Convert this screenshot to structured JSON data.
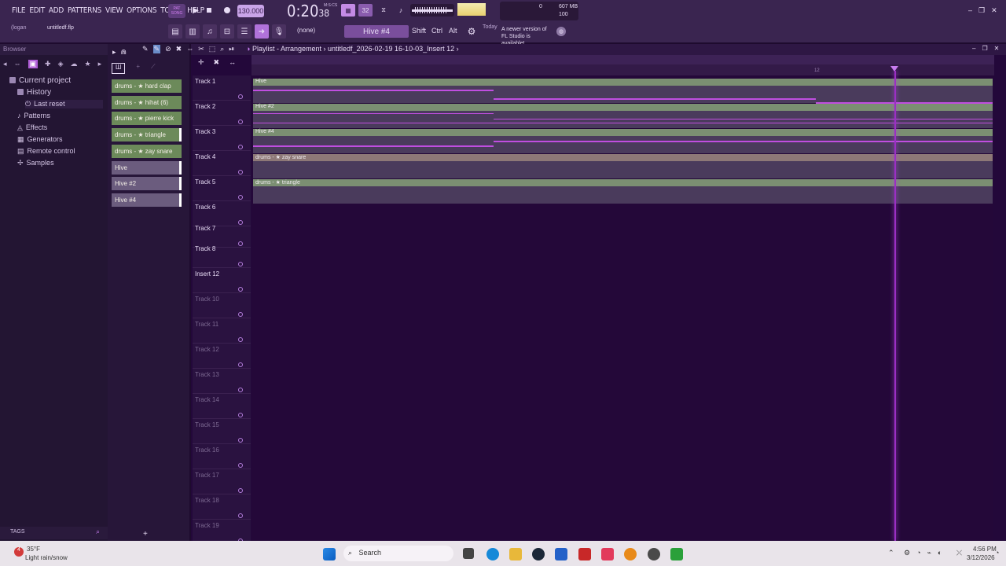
{
  "menubar": {
    "items": [
      "FILE",
      "EDIT",
      "ADD",
      "PATTERNS",
      "VIEW",
      "OPTIONS",
      "TOOLS",
      "HELP"
    ],
    "pat_song": "PAT SONG",
    "tempo": "130.000",
    "time_main": "0:20",
    "time_sub": "38",
    "time_format": "M:S:CS",
    "cpu_label": "607 MB",
    "cpu_value": "100",
    "cpu_zero": "0"
  },
  "hintbar": {
    "user": "(logan",
    "file": "untitledf.flp",
    "pattern_none": "(none)",
    "pattern": "Hive #4",
    "shift": "Shift",
    "ctrl": "Ctrl",
    "alt": "Alt",
    "news_date": "Today",
    "news_text": "A newer version of FL Studio is available!"
  },
  "browser": {
    "title": "Browser",
    "items": [
      {
        "label": "Current project",
        "indent": 0
      },
      {
        "label": "History",
        "indent": 1
      },
      {
        "label": "Last reset",
        "indent": 2
      },
      {
        "label": "Patterns",
        "indent": 1
      },
      {
        "label": "Effects",
        "indent": 1
      },
      {
        "label": "Generators",
        "indent": 1
      },
      {
        "label": "Remote control",
        "indent": 1
      },
      {
        "label": "Samples",
        "indent": 1
      }
    ],
    "tags": "TAGS"
  },
  "channels": [
    {
      "label": "drums - ★ hard clap",
      "kind": "g"
    },
    {
      "label": "drums - ★ hihat (6)",
      "kind": "g"
    },
    {
      "label": "drums - ★ pierre kick",
      "kind": "g"
    },
    {
      "label": "drums - ★ triangle",
      "kind": "g"
    },
    {
      "label": "drums - ★ zay snare",
      "kind": "g"
    },
    {
      "label": "Hive",
      "kind": "p"
    },
    {
      "label": "Hive #2",
      "kind": "p"
    },
    {
      "label": "Hive #4",
      "kind": "p"
    }
  ],
  "playlist": {
    "title": "Playlist - Arrangement",
    "breadcrumb": "untitledf_2026-02-19 16-10-03_Insert 12",
    "ruler_mark": "12",
    "tracks": [
      "Track 1",
      "Track 2",
      "Track 3",
      "Track 4",
      "Track 5",
      "Track 6",
      "Track 7",
      "Track 8",
      "Insert 12",
      "Track 10",
      "Track 11",
      "Track 12",
      "Track 13",
      "Track 14",
      "Track 15",
      "Track 16",
      "Track 17",
      "Track 18",
      "Track 19"
    ],
    "clips": [
      "Hive",
      "Hive #2",
      "Hive #4",
      "drums - ★ zay snare",
      "drums - ★ triangle"
    ]
  },
  "taskbar": {
    "weather_temp": "35°F",
    "weather_desc": "Light rain/snow",
    "search": "Search",
    "time": "4:56 PM",
    "date": "3/12/2026",
    "badge": "4"
  }
}
